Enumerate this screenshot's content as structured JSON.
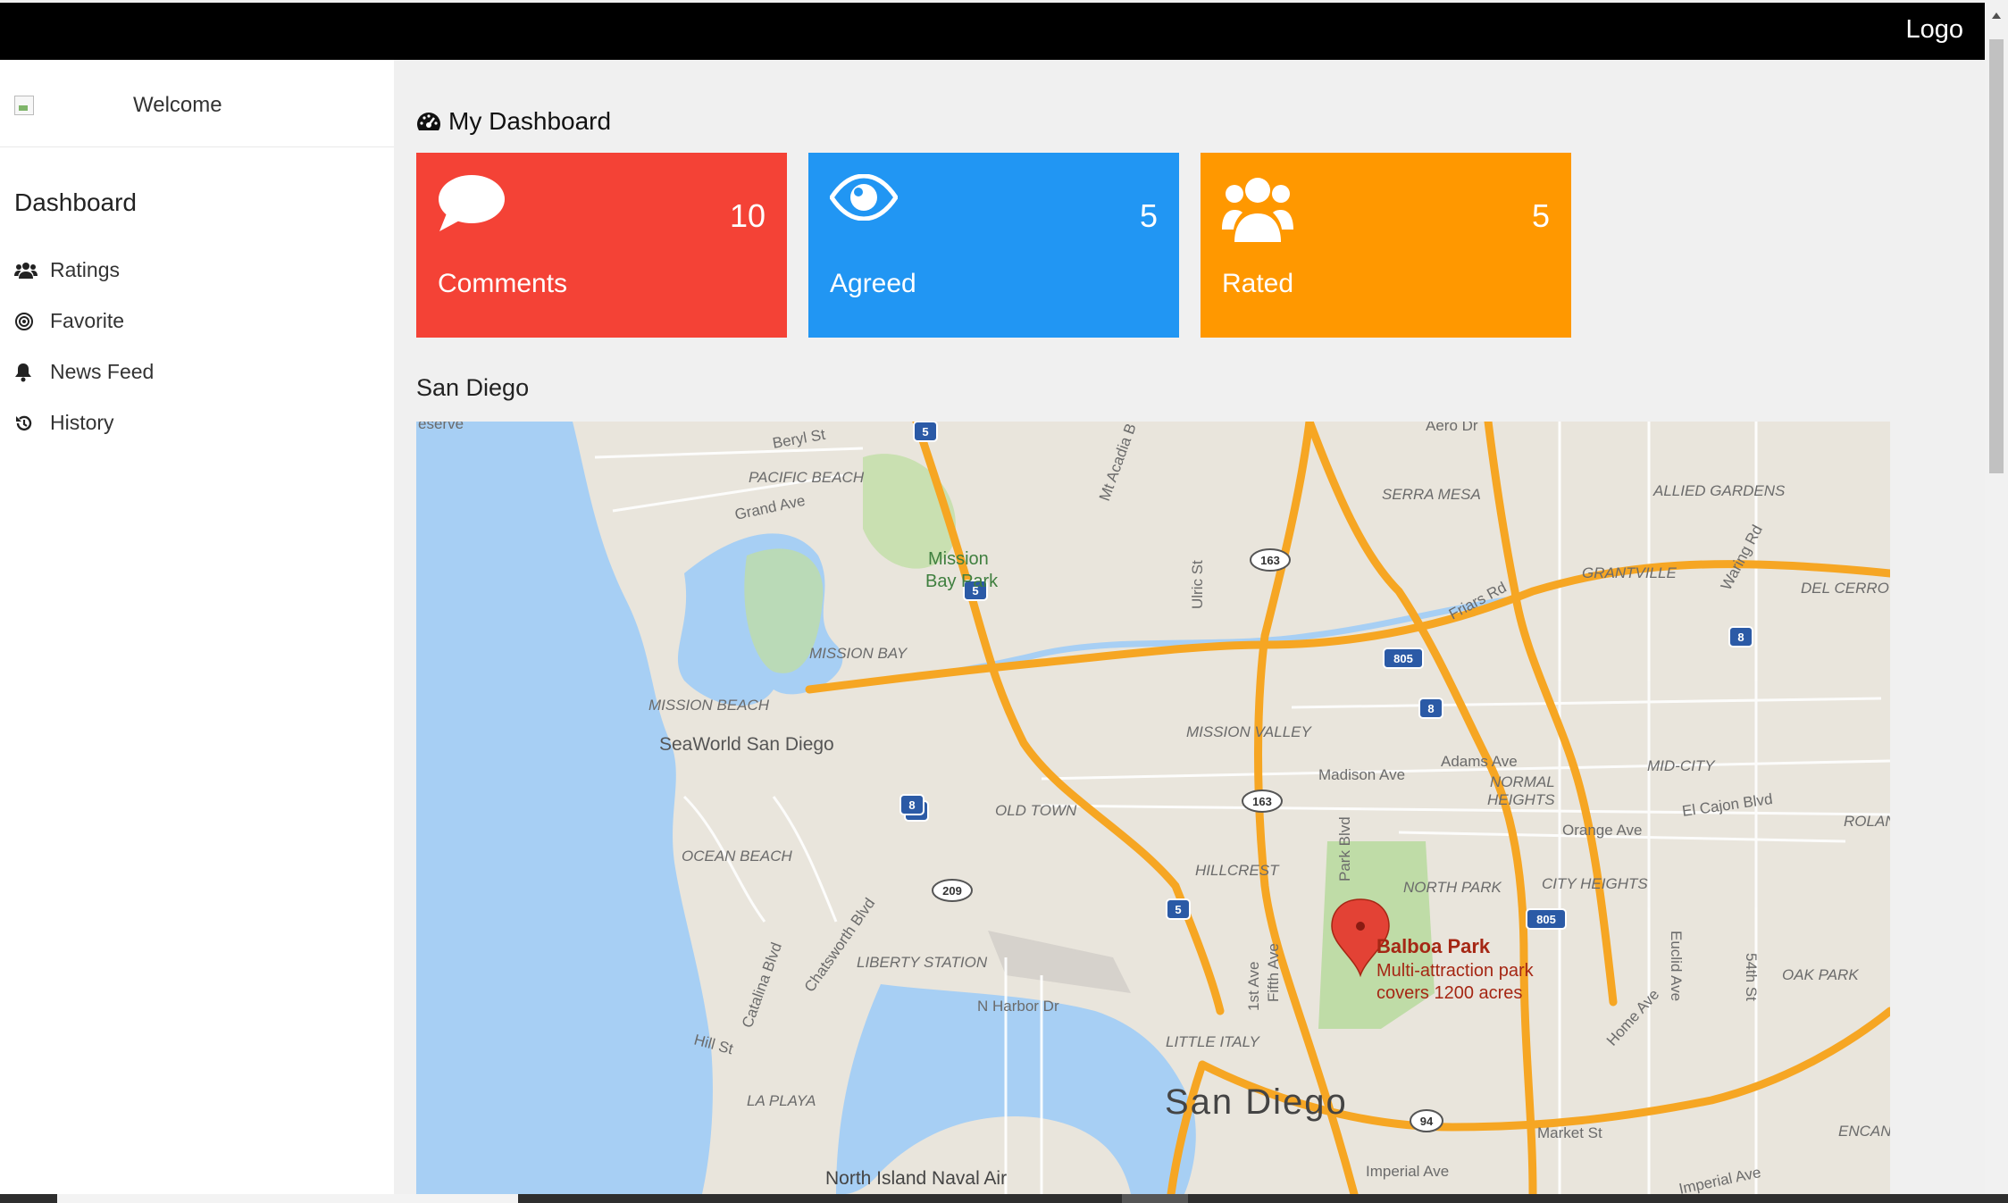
{
  "header": {
    "logo": "Logo"
  },
  "sidebar": {
    "welcome": "Welcome",
    "section_title": "Dashboard",
    "items": [
      {
        "label": "Ratings",
        "icon": "users-icon"
      },
      {
        "label": "Favorite",
        "icon": "target-icon"
      },
      {
        "label": "News Feed",
        "icon": "bell-icon"
      },
      {
        "label": "History",
        "icon": "history-icon"
      }
    ]
  },
  "main": {
    "title": "My Dashboard",
    "cards": [
      {
        "label": "Comments",
        "value": "10",
        "color": "#f44236",
        "icon": "comment-icon"
      },
      {
        "label": "Agreed",
        "value": "5",
        "color": "#2196f3",
        "icon": "eye-icon"
      },
      {
        "label": "Rated",
        "value": "5",
        "color": "#ff9800",
        "icon": "users-icon"
      }
    ],
    "map_title": "San Diego",
    "map": {
      "labels": {
        "reserve": "eserve",
        "beryl": "Beryl St",
        "pacific_beach": "PACIFIC BEACH",
        "grand_ave": "Grand Ave",
        "mission_bay_park_1": "Mission",
        "mission_bay_park_2": "Bay Park",
        "mission_bay": "MISSION BAY",
        "mission_beach": "MISSION BEACH",
        "seaworld": "SeaWorld San Diego",
        "ocean_beach": "OCEAN BEACH",
        "old_town": "OLD TOWN",
        "liberty_station": "LIBERTY STATION",
        "catalina": "Catalina Blvd",
        "chatsworth": "Chatsworth Blvd",
        "hill_st": "Hill St",
        "la_playa": "LA PLAYA",
        "n_harbor": "N Harbor Dr",
        "north_island": "North Island Naval Air",
        "little_italy": "LITTLE ITALY",
        "san_diego": "San Diego",
        "hillcrest": "HILLCREST",
        "mission_valley": "MISSION VALLEY",
        "madison": "Madison Ave",
        "adams": "Adams Ave",
        "normal_heights_1": "NORMAL",
        "normal_heights_2": "HEIGHTS",
        "north_park": "NORTH PARK",
        "city_heights": "CITY HEIGHTS",
        "orange_ave": "Orange Ave",
        "mid_city": "MID-CITY",
        "el_cajon": "El Cajon Blvd",
        "serra_mesa": "SERRA MESA",
        "allied_gardens": "ALLIED GARDENS",
        "grantville": "GRANTVILLE",
        "del_cerro": "DEL CERRO",
        "friars": "Friars Rd",
        "waring": "Waring Rd",
        "aero": "Aero Dr",
        "mt_acadia": "Mt Acadia B",
        "ulric": "Ulric St",
        "park_blvd": "Park Blvd",
        "fifth_ave": "Fifth Ave",
        "first_ave": "1st Ave",
        "euclid": "Euclid Ave",
        "st_54": "54th St",
        "home_ave": "Home Ave",
        "oak_park": "OAK PARK",
        "rolando": "ROLAN",
        "encanto": "ENCANT",
        "market_st": "Market St",
        "imperial_ave": "Imperial Ave",
        "imperial_ave_2": "Imperial Ave",
        "balboa_title": "Balboa Park",
        "balboa_desc_1": "Multi-attraction park",
        "balboa_desc_2": "covers 1200 acres"
      },
      "shields": [
        "5",
        "5",
        "5",
        "5",
        "8",
        "8",
        "8",
        "805",
        "805",
        "163",
        "163",
        "209",
        "94"
      ]
    }
  }
}
